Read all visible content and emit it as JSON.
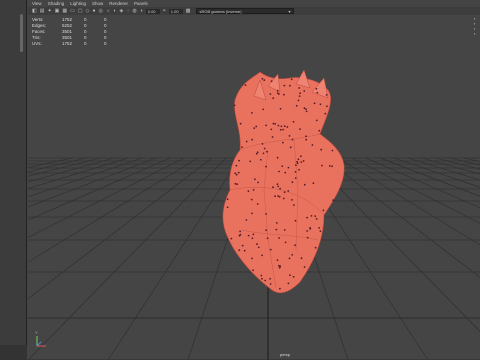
{
  "menu": [
    "View",
    "Shading",
    "Lighting",
    "Show",
    "Renderer",
    "Panels"
  ],
  "toolbar": {
    "field_a": "0.00",
    "field_b": "1.00",
    "colorspace": "sRGB gamma (Inverse)"
  },
  "hud": [
    {
      "label": "Verts:",
      "a": "1752",
      "b": "0",
      "c": "0"
    },
    {
      "label": "Edges:",
      "a": "5252",
      "b": "0",
      "c": "0"
    },
    {
      "label": "Faces:",
      "a": "3501",
      "b": "0",
      "c": "0"
    },
    {
      "label": "Tris:",
      "a": "3501",
      "b": "0",
      "c": "0"
    },
    {
      "label": "UVs:",
      "a": "1752",
      "b": "0",
      "c": "0"
    }
  ],
  "axis": {
    "y": "Y",
    "x": "X",
    "z": "Z"
  },
  "camera": "persp",
  "colors": {
    "mesh": "#e9725f",
    "grid": "#2d2d2d",
    "background": "#454545"
  }
}
